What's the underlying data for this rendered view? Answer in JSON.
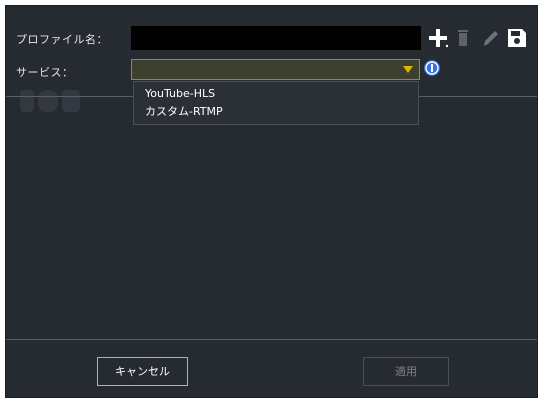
{
  "form": {
    "profile_name_label": "プロファイル名：",
    "profile_name_value": "",
    "service_label": "サービス：",
    "service_selected": ""
  },
  "toolbar": {
    "icons": [
      "add-icon",
      "delete-icon",
      "edit-icon",
      "save-icon"
    ]
  },
  "service_dropdown": {
    "options": [
      "YouTube-HLS",
      "カスタム-RTMP"
    ]
  },
  "footer": {
    "cancel_label": "キャンセル",
    "apply_label": "適用"
  },
  "colors": {
    "dialog_background": "#262a31",
    "input_background": "#000000",
    "select_border": "#8b8a4f",
    "chevron": "#e6b400",
    "info_icon": "#3b6fe0"
  }
}
